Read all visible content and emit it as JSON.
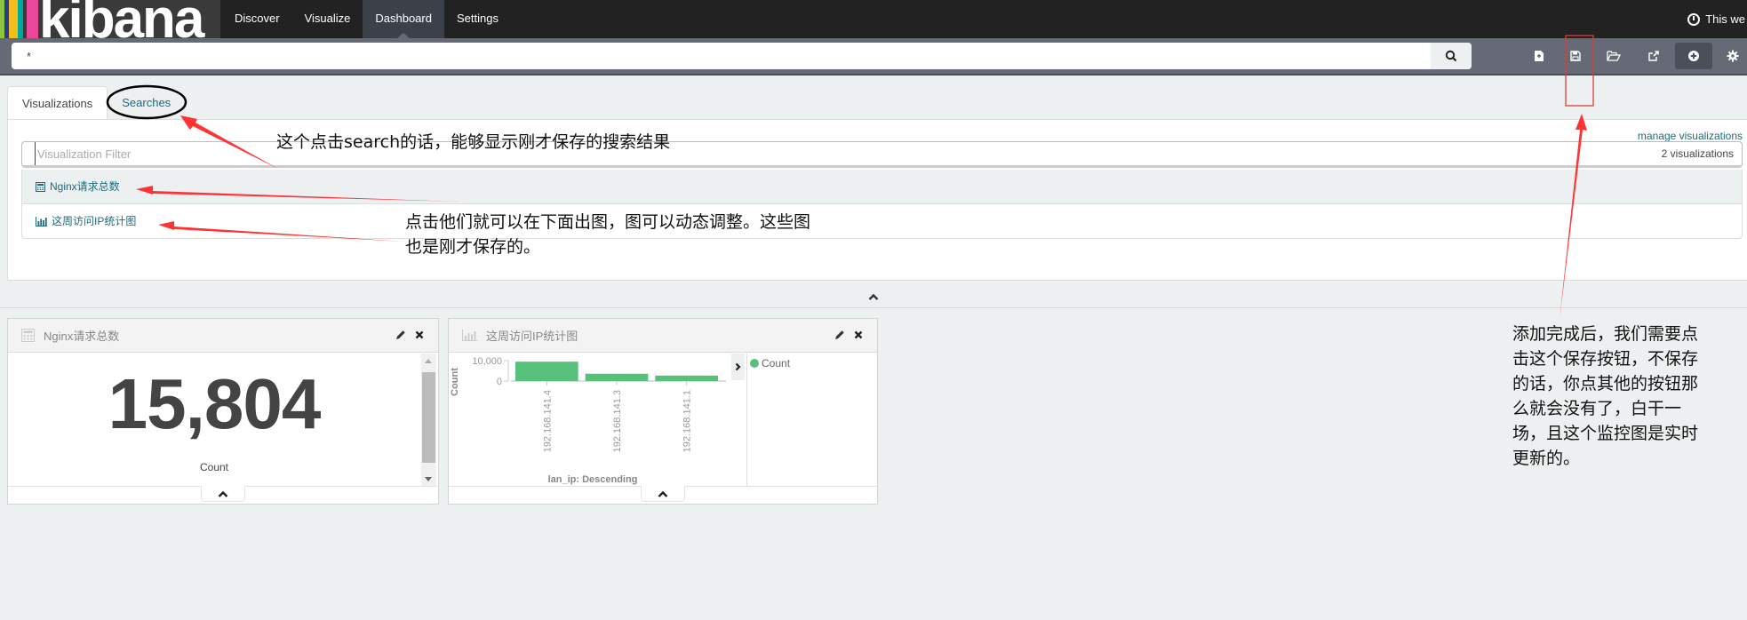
{
  "app": {
    "brand": "kibana",
    "brand_stripes": [
      "#8cc63f",
      "#253c8f",
      "#f4bc1c",
      "#00a79d",
      "#ec4899"
    ]
  },
  "nav": {
    "links": [
      {
        "label": "Discover",
        "active": false
      },
      {
        "label": "Visualize",
        "active": false
      },
      {
        "label": "Dashboard",
        "active": true
      },
      {
        "label": "Settings",
        "active": false
      }
    ],
    "timepicker_label": "This we"
  },
  "toolbar": {
    "query_value": "*",
    "search_icon": "search-icon",
    "buttons": [
      {
        "name": "new-dashboard",
        "icon": "new-file-icon"
      },
      {
        "name": "save-dashboard",
        "icon": "save-icon"
      },
      {
        "name": "load-dashboard",
        "icon": "folder-open-icon"
      },
      {
        "name": "share-dashboard",
        "icon": "external-link-icon"
      },
      {
        "name": "add-visualization",
        "icon": "plus-circle-icon",
        "active": true
      },
      {
        "name": "options",
        "icon": "gear-icon"
      }
    ]
  },
  "picker": {
    "tabs": [
      {
        "label": "Visualizations",
        "active": true
      },
      {
        "label": "Searches",
        "active": false
      }
    ],
    "manage_link": "manage visualizations",
    "filter_placeholder": "Visualization Filter",
    "filter_value": "",
    "count_label": "2 visualizations",
    "items": [
      {
        "label": "Nginx请求总数",
        "icon": "calculator-icon"
      },
      {
        "label": "这周访问IP统计图",
        "icon": "bar-chart-icon"
      }
    ]
  },
  "panels": [
    {
      "title": "Nginx请求总数",
      "icon": "calculator-icon",
      "metric_value": "15,804",
      "metric_label": "Count"
    },
    {
      "title": "这周访问IP统计图",
      "icon": "bar-chart-icon",
      "legend": [
        {
          "label": "Count",
          "color": "#57c17b"
        }
      ]
    }
  ],
  "chart_data": {
    "type": "bar",
    "title": "这周访问IP统计图",
    "xlabel": "lan_ip: Descending",
    "ylabel": "Count",
    "categories": [
      "192.168.141.4",
      "192.168.141.3",
      "192.168.141.1"
    ],
    "values": [
      9500,
      3600,
      2700
    ],
    "ylim": [
      0,
      10000
    ],
    "yticks": [
      {
        "value": 0,
        "label": "0"
      },
      {
        "value": 10000,
        "label": "10,000"
      }
    ],
    "series_color": "#57c17b",
    "legend": [
      "Count"
    ],
    "legend_position": "right"
  },
  "annotations": {
    "searches_note": "这个点击search的话，能够显示刚才保存的搜索结果",
    "list_note_line1": "点击他们就可以在下面出图，图可以动态调整。这些图",
    "list_note_line2": "也是刚才保存的。",
    "save_note_lines": [
      "添加完成后，我们需要点",
      "击这个保存按钮，不保存",
      "的话，你点其他的按钮那",
      "么就会没有了，白干一",
      "场，且这个监控图是实时",
      "更新的。"
    ],
    "arrow_color": "#ff3333",
    "ellipse_color": "#000000",
    "highlight_box_color": "#e53935"
  }
}
